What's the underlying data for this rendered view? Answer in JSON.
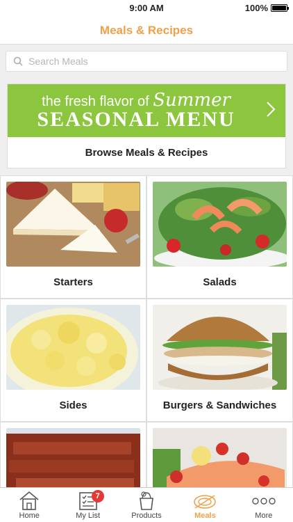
{
  "status_bar": {
    "time": "9:00 AM",
    "battery": "100%",
    "battery_level": 1.0
  },
  "nav": {
    "title": "Meals & Recipes"
  },
  "search": {
    "placeholder": "Search Meals"
  },
  "promo": {
    "line1_prefix": "the fresh flavor of",
    "line1_script": "Summer",
    "line2": "SEASONAL MENU",
    "browse_label": "Browse Meals & Recipes",
    "banner_color": "#8cc63f"
  },
  "categories": [
    {
      "label": "Starters"
    },
    {
      "label": "Salads"
    },
    {
      "label": "Sides"
    },
    {
      "label": "Burgers & Sandwiches"
    },
    {
      "label": ""
    },
    {
      "label": ""
    }
  ],
  "tabs": [
    {
      "label": "Home",
      "icon": "home-icon"
    },
    {
      "label": "My List",
      "icon": "list-icon",
      "badge": "7"
    },
    {
      "label": "Products",
      "icon": "bag-icon"
    },
    {
      "label": "Meals",
      "icon": "plate-icon",
      "active": true
    },
    {
      "label": "More",
      "icon": "more-icon"
    }
  ],
  "colors": {
    "accent": "#f0a04b",
    "badge": "#e53935"
  }
}
